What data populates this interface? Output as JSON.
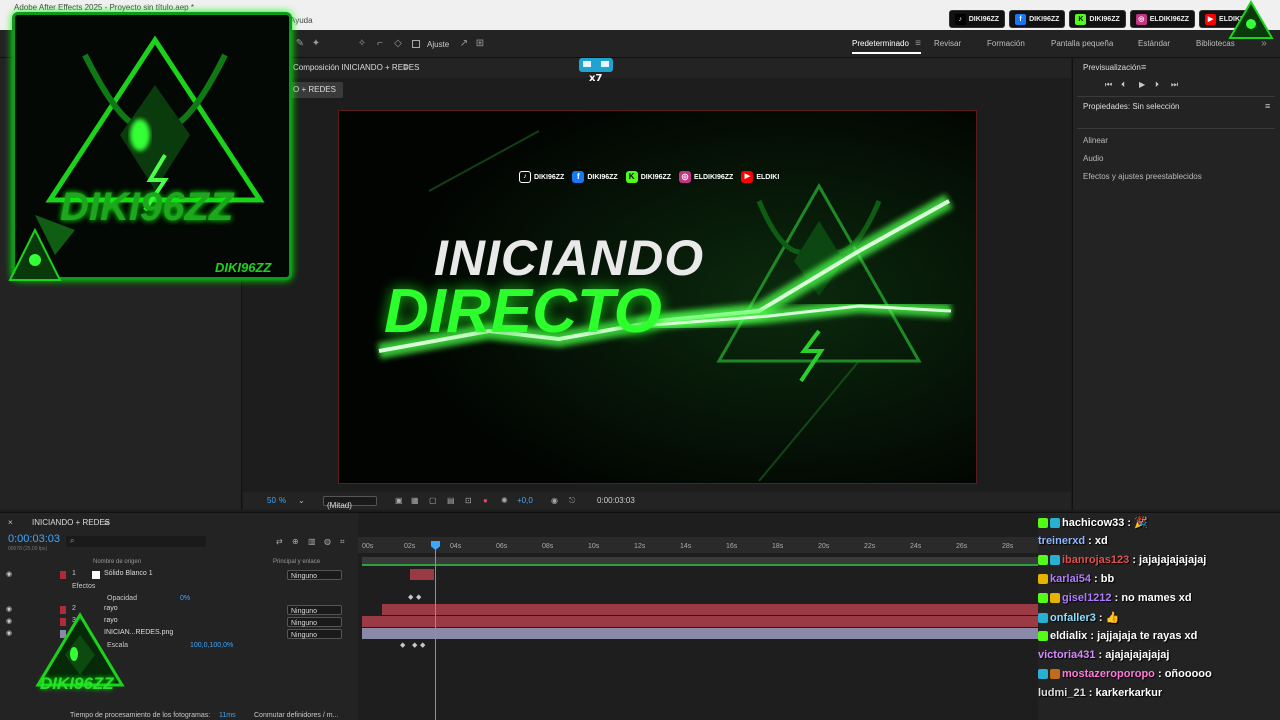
{
  "titlebar": {
    "title": "Adobe After Effects 2025 - Proyecto sin título.aep *",
    "menu_help": "Ayuda"
  },
  "toolbar": {
    "snap_label": "Ajuste"
  },
  "workspaces": [
    "Predeterminado",
    "Revisar",
    "Formación",
    "Pantalla pequeña",
    "Estándar",
    "Bibliotecas"
  ],
  "social_top": [
    {
      "label": "DIKI96ZZ",
      "icon": "tiktok-icon",
      "color": "#111111"
    },
    {
      "label": "DIKI96ZZ",
      "icon": "facebook-icon",
      "color": "#1877f2"
    },
    {
      "label": "DIKI96ZZ",
      "icon": "kick-icon",
      "color": "#53fc18"
    },
    {
      "label": "ELDIKI96ZZ",
      "icon": "instagram-icon",
      "color": "#c13584"
    },
    {
      "label": "ELDIKI",
      "icon": "youtube-icon",
      "color": "#ff0000"
    }
  ],
  "comp_panel": {
    "title": "Composición INICIANDO + REDES",
    "tab": "O + REDES"
  },
  "viewer": {
    "headline_1": "INICIANDO",
    "headline_2": "DIRECTO",
    "socials": [
      {
        "label": "DIKI96ZZ",
        "icon": "tiktok-icon",
        "color": "#111111"
      },
      {
        "label": "DIKI96ZZ",
        "icon": "facebook-icon",
        "color": "#1877f2"
      },
      {
        "label": "DIKI96ZZ",
        "icon": "kick-icon",
        "color": "#53fc18"
      },
      {
        "label": "ELDIKI96ZZ",
        "icon": "instagram-icon",
        "color": "#c13584"
      },
      {
        "label": "ELDIKI",
        "icon": "youtube-icon",
        "color": "#ff0000"
      }
    ]
  },
  "viewer_bar": {
    "zoom": "50",
    "zoom_unit": "%",
    "resolution": "(Mitad)",
    "exposure": "+0,0",
    "timecode": "0:00:03:03"
  },
  "right_panel": {
    "preview_title": "Previsualización",
    "properties_title": "Propiedades: Sin selección",
    "items": [
      "Alinear",
      "Audio",
      "Efectos y ajustes preestablecidos"
    ]
  },
  "timeline": {
    "comp_name": "INICIANDO + REDES",
    "timecode": "0:00:03:03",
    "frame_info": "00078 (25,00 fps)",
    "col_name": "Nombre de origen",
    "col_parent": "Principal y enlace",
    "ruler": [
      "00s",
      "02s",
      "04s",
      "06s",
      "08s",
      "10s",
      "12s",
      "14s",
      "16s",
      "18s",
      "20s",
      "22s",
      "24s",
      "26s",
      "28s"
    ],
    "layers": [
      {
        "num": "1",
        "name": "Sólido Blanco 1",
        "parent": "Ninguno"
      },
      {
        "num": "2",
        "name": "rayo",
        "parent": "Ninguno"
      },
      {
        "num": "3",
        "name": "rayo",
        "parent": "Ninguno"
      },
      {
        "num": "4",
        "name": "INICIAN...REDES.png",
        "parent": "Ninguno"
      }
    ],
    "effects_label": "Efectos",
    "opacity_label": "Opacidad",
    "opacity_value": "0%",
    "scale_label": "Escala",
    "scale_value": "100,0,100,0%",
    "status": "Tiempo de procesamiento de los fotogramas:",
    "status_value": "11ms",
    "toggle": "Conmutar definidores / m..."
  },
  "logo": {
    "text": "DIKI96ZZ",
    "small_text": "DIKI96ZZ",
    "bottom_text": "DIKI96ZZ"
  },
  "chat": [
    {
      "user": "hachicow33",
      "msg": "🎉",
      "color": "#ffffff",
      "badge": "#27b0d1"
    },
    {
      "user": "treinerxd",
      "msg": "xd",
      "color": "#8fb7ff",
      "badge": ""
    },
    {
      "user": "ibanrojas123",
      "msg": "jajajajajajajaj",
      "color": "#e05050",
      "badge": "#27b0d1"
    },
    {
      "user": "karlai54",
      "msg": "bb",
      "color": "#b07cff",
      "badge": "#e8b200"
    },
    {
      "user": "gisel1212",
      "msg": "no mames xd",
      "color": "#b07cff",
      "badge": "#e8b200"
    },
    {
      "user": "onfaller3",
      "msg": "👍",
      "color": "#8fdfff",
      "badge": "#27b0d1"
    },
    {
      "user": "eldialix",
      "msg": "jajjajaja te rayas xd",
      "color": "#ffffff",
      "badge": "#53fc18"
    },
    {
      "user": "victoria431",
      "msg": "ajajajajajajaj",
      "color": "#d58bff",
      "badge": ""
    },
    {
      "user": "mostazeroporopo",
      "msg": "oñooooo",
      "color": "#ff7ad9",
      "badge": "#27b0d1"
    },
    {
      "user": "ludmi_21",
      "msg": "karkerkarkur",
      "color": "#dddddd",
      "badge": ""
    }
  ]
}
